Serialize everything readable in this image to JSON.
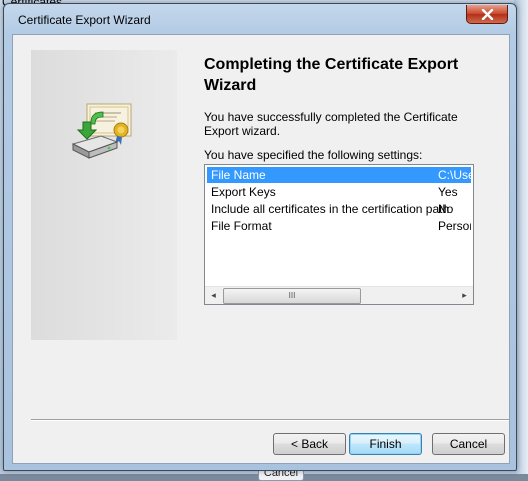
{
  "background": {
    "window_title": "Certificates",
    "bottom_button_label": "Cancel"
  },
  "window": {
    "title": "Certificate Export Wizard",
    "close_icon": "close-icon"
  },
  "content": {
    "heading": "Completing the Certificate Export Wizard",
    "success_message": "You have successfully completed the Certificate Export wizard.",
    "settings_intro": "You have specified the following settings:"
  },
  "settings": [
    {
      "key": "File Name",
      "value": "C:\\User",
      "selected": true
    },
    {
      "key": "Export Keys",
      "value": "Yes",
      "selected": false
    },
    {
      "key": "Include all certificates in the certification path",
      "value": "No",
      "selected": false
    },
    {
      "key": "File Format",
      "value": "Persona",
      "selected": false
    }
  ],
  "scrollbar": {
    "left_arrow": "◂",
    "right_arrow": "▸",
    "thumb_grip": "III"
  },
  "buttons": {
    "back": "< Back",
    "finish": "Finish",
    "cancel": "Cancel"
  },
  "icons": {
    "side_graphic": "certificate-export-icon"
  },
  "colors": {
    "selection": "#3399ff",
    "close_button": "#c9452a"
  }
}
